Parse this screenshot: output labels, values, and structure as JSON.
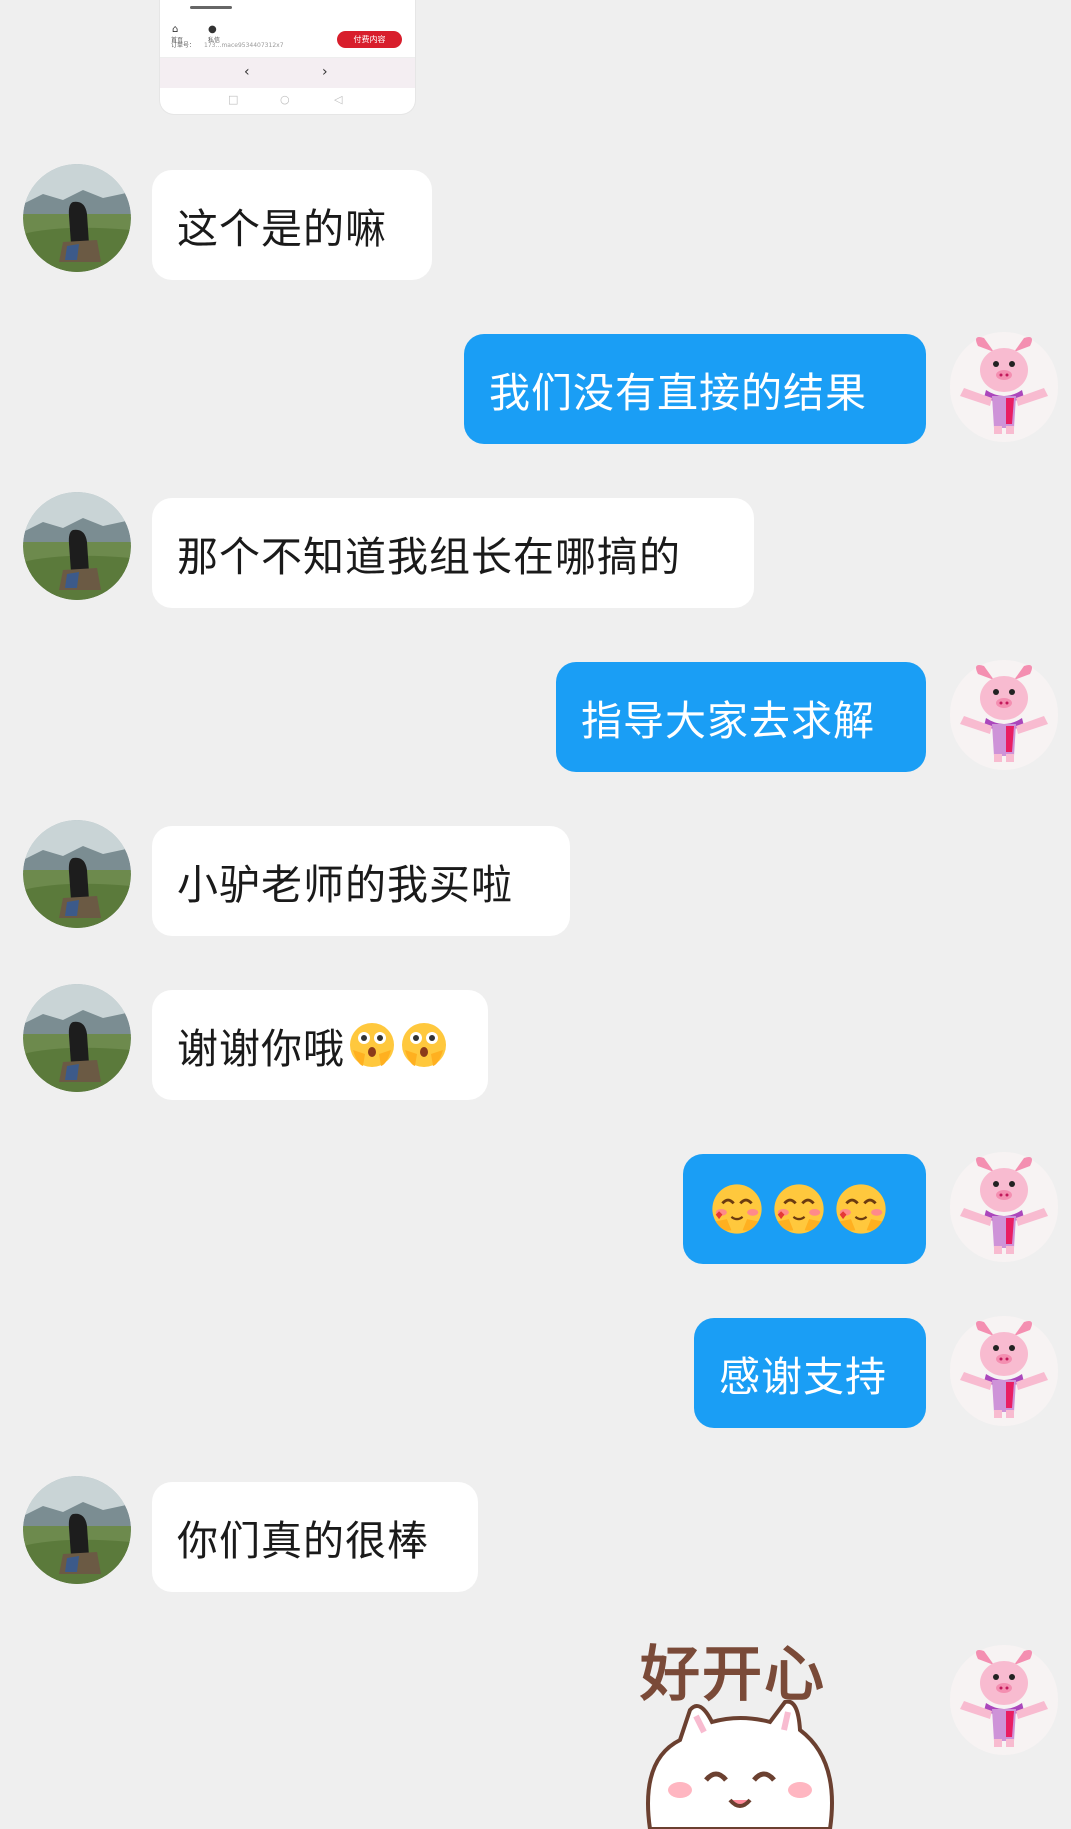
{
  "screenshot": {
    "pay_button": "付费内容",
    "home_label": "首页",
    "chat_label": "私信",
    "order_prefix": "订单号：",
    "order_number": "173…mace9534407312x7",
    "nav_back": "‹",
    "nav_forward": "›"
  },
  "messages": [
    {
      "side": "in",
      "text": "这个是的嘛"
    },
    {
      "side": "out",
      "text": "我们没有直接的结果"
    },
    {
      "side": "in",
      "text": "那个不知道我组长在哪搞的"
    },
    {
      "side": "out",
      "text": "指导大家去求解"
    },
    {
      "side": "in",
      "text": "小驴老师的我买啦"
    },
    {
      "side": "in",
      "text": "谢谢你哦",
      "emoji": [
        "scared-face",
        "scared-face"
      ]
    },
    {
      "side": "out",
      "text": "",
      "emoji": [
        "blushing-heart-face",
        "blushing-heart-face",
        "blushing-heart-face"
      ]
    },
    {
      "side": "out",
      "text": "感谢支持"
    },
    {
      "side": "in",
      "text": "你们真的很棒"
    }
  ],
  "sticker": {
    "text": "好开心",
    "image": "happy-white-cat"
  },
  "colors": {
    "background": "#efefef",
    "outgoing_bubble": "#1a9ef5",
    "incoming_bubble": "#ffffff",
    "pay_button": "#d81e2c"
  }
}
